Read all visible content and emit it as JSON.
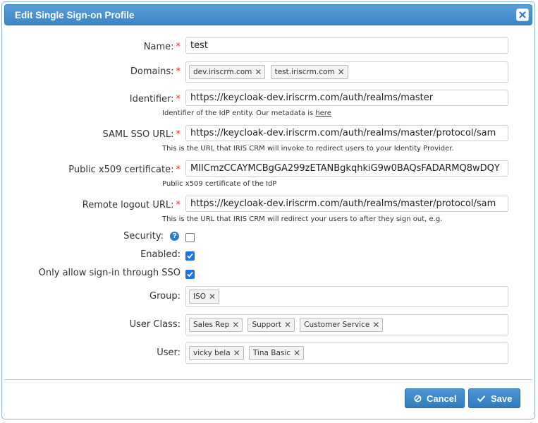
{
  "dialog": {
    "title": "Edit Single Sign-on Profile"
  },
  "form": {
    "name": {
      "label": "Name:",
      "value": "test"
    },
    "domains": {
      "label": "Domains:",
      "tags": [
        "dev.iriscrm.com",
        "test.iriscrm.com"
      ]
    },
    "identifier": {
      "label": "Identifier:",
      "value": "https://keycloak-dev.iriscrm.com/auth/realms/master",
      "hint": "Identifier of the IdP entity. Our metadata is ",
      "hint_link": "here"
    },
    "saml_sso_url": {
      "label": "SAML SSO URL:",
      "value": "https://keycloak-dev.iriscrm.com/auth/realms/master/protocol/sam",
      "hint": "This is the URL that IRIS CRM will invoke to redirect users to your Identity Provider."
    },
    "certificate": {
      "label": "Public x509 certificate:",
      "value": "MIICmzCCAYMCBgGA299zETANBgkqhkiG9w0BAQsFADARMQ8wDQY",
      "hint": "Public x509 certificate of the IdP"
    },
    "remote_logout_url": {
      "label": "Remote logout URL:",
      "value": "https://keycloak-dev.iriscrm.com/auth/realms/master/protocol/sam",
      "hint": "This is the URL that IRIS CRM will redirect your users to after they sign out, e.g."
    },
    "security": {
      "label": "Security:",
      "help": "?",
      "checked": false
    },
    "enabled": {
      "label": "Enabled:",
      "checked": true
    },
    "sso_only": {
      "label": "Only allow sign-in through SSO",
      "checked": true
    },
    "group": {
      "label": "Group:",
      "tags": [
        "ISO"
      ]
    },
    "user_class": {
      "label": "User Class:",
      "tags": [
        "Sales Rep",
        "Support",
        "Customer Service"
      ]
    },
    "user": {
      "label": "User:",
      "tags": [
        "vicky bela",
        "Tina Basic"
      ]
    },
    "required_mark": "*"
  },
  "buttons": {
    "cancel": "Cancel",
    "save": "Save"
  },
  "icons": {
    "close": "close-icon",
    "cancel": "cancel-circle-icon",
    "save": "check-icon",
    "help": "help-circle-icon",
    "tag_remove": "x-icon"
  },
  "colors": {
    "titlebar": "#3b86c6",
    "button": "#2f7bbf",
    "required": "#d9342b",
    "checkbox": "#1a73e8"
  }
}
